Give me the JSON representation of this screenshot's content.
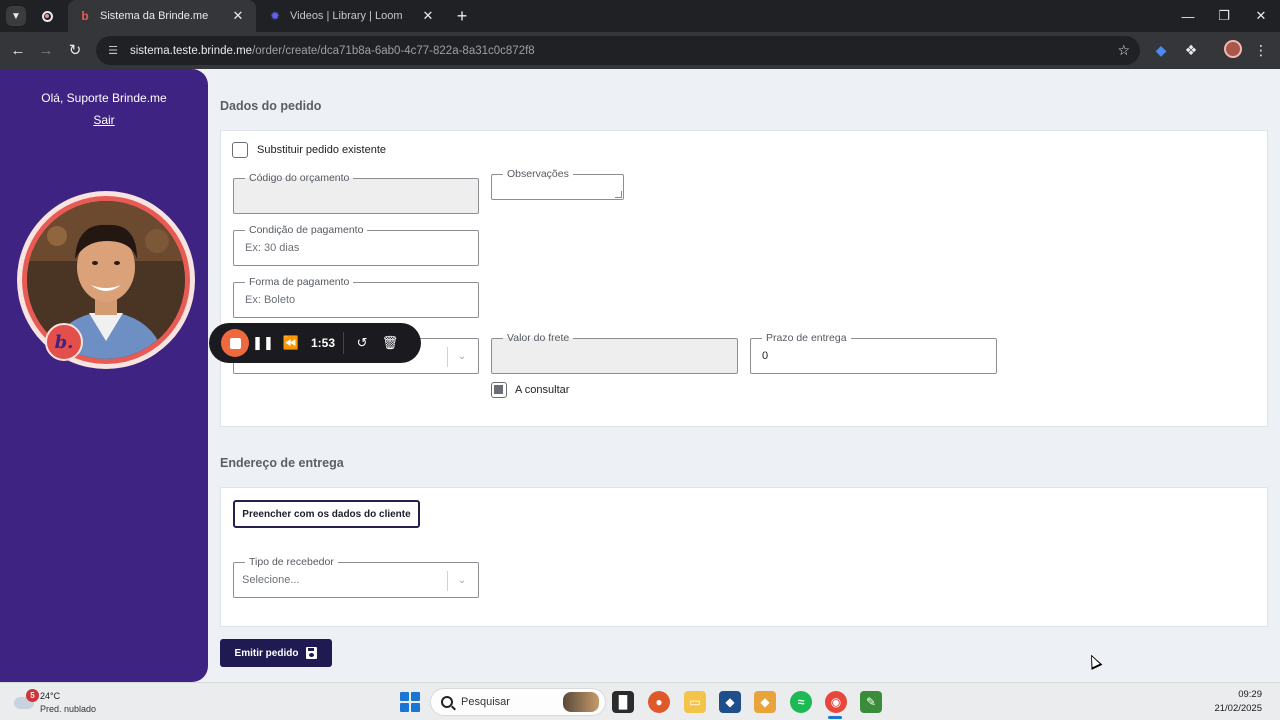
{
  "browser": {
    "tabs": [
      {
        "title": "Sistema da Brinde.me",
        "active": true
      },
      {
        "title": "Videos | Library | Loom",
        "active": false
      }
    ],
    "url_host": "sistema.teste.brinde.me",
    "url_path": "/order/create/dca71b8a-6ab0-4c77-822a-8a31c0c872f8"
  },
  "sidebar": {
    "greeting": "Olá, Suporte Brinde.me",
    "logout": "Sair",
    "badge_letter": "b."
  },
  "order": {
    "section_title": "Dados do pedido",
    "replace_checkbox_label": "Substituir pedido existente",
    "budget_code_label": "Código do orçamento",
    "notes_label": "Observações",
    "payment_condition_label": "Condição de pagamento",
    "payment_condition_placeholder": "Ex: 30 dias",
    "payment_method_label": "Forma de pagamento",
    "payment_method_placeholder": "Ex: Boleto",
    "freight_label": "Valor do frete",
    "delivery_label": "Prazo de entrega",
    "delivery_value": "0",
    "consult_label": "A consultar"
  },
  "address": {
    "section_title": "Endereço de entrega",
    "fill_button": "Preencher com os dados do cliente",
    "receiver_label": "Tipo de recebedor",
    "receiver_placeholder": "Selecione..."
  },
  "submit_button": "Emitir pedido",
  "recorder": {
    "time": "1:53"
  },
  "taskbar": {
    "weather_badge": "5",
    "temperature": "24°C",
    "weather_desc": "Pred. nublado",
    "search_placeholder": "Pesquisar",
    "time": "09:29",
    "date": "21/02/2025"
  },
  "colors": {
    "sidebar": "#3f2382",
    "primary_button": "#1f1a52",
    "stop_button": "#ee6a3e",
    "page_background": "#edf0f4"
  }
}
